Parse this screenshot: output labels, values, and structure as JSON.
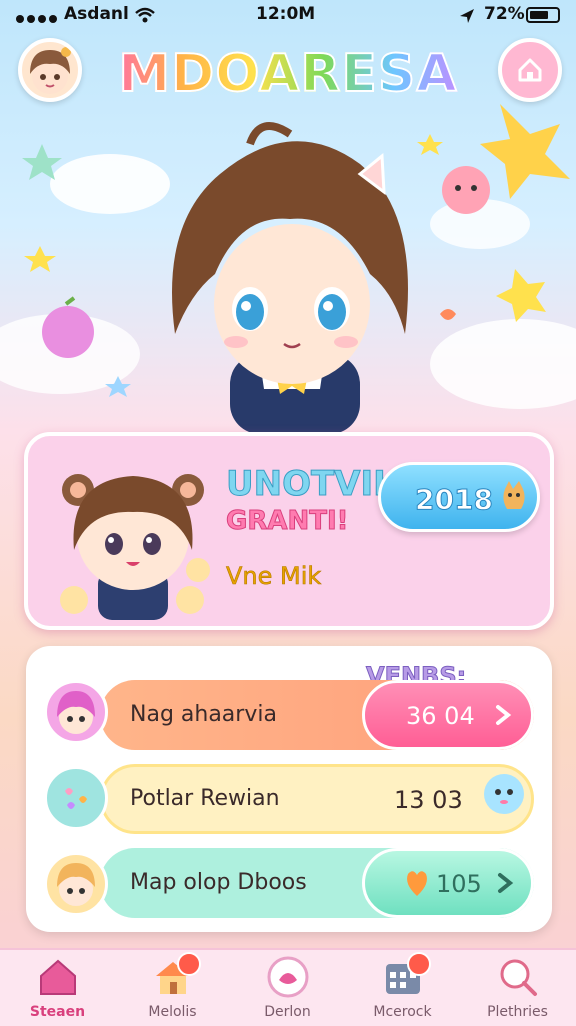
{
  "status": {
    "carrier": "Asdanl",
    "time": "12:0M",
    "battery": "72%"
  },
  "header": {
    "title": "MDOARESA"
  },
  "profile": {
    "name": "UNOTVIK",
    "congrats": "GRANTI!",
    "subtitle": "Vne Mik",
    "score": "2018"
  },
  "list": {
    "weeks_label": "VENBS:",
    "rows": [
      {
        "label": "Nag ahaarvia",
        "value": "36 04"
      },
      {
        "label": "Potlar Rewian",
        "value": "13 03"
      },
      {
        "label": "Map olop Dboos",
        "value": "105"
      }
    ]
  },
  "tabs": [
    {
      "label": "Steaen"
    },
    {
      "label": "Melolis"
    },
    {
      "label": "Derlon"
    },
    {
      "label": "Mcerock"
    },
    {
      "label": "Plethries"
    }
  ],
  "colors": {
    "accent": "#ff6fa6",
    "profile_card": "#fbd1ea",
    "score_pill": "#3fb3ee"
  }
}
